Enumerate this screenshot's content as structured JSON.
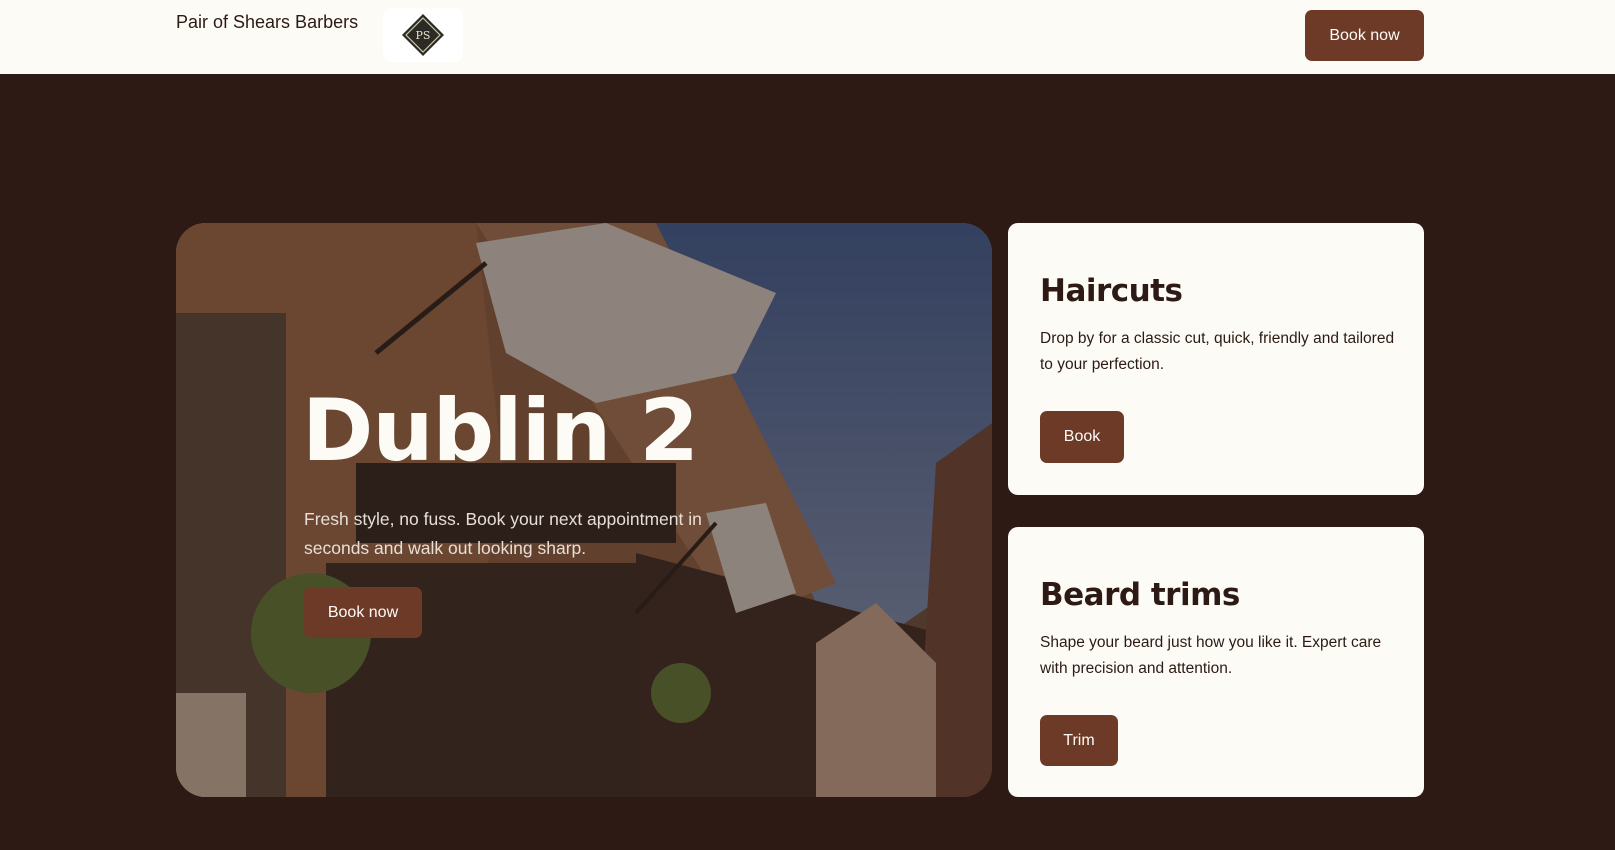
{
  "header": {
    "brand": "Pair of Shears Barbers",
    "logo_text": "PS",
    "book_label": "Book now"
  },
  "hero": {
    "title": "Dublin 2",
    "text": "Fresh style, no fuss. Book your next appointment in seconds and walk out looking sharp.",
    "button_label": "Book now"
  },
  "services": [
    {
      "title": "Haircuts",
      "text": "Drop by for a classic cut, quick, friendly and tailored to your perfection.",
      "button_label": "Book"
    },
    {
      "title": "Beard trims",
      "text": "Shape your beard just how you like it. Expert care with precision and attention.",
      "button_label": "Trim"
    }
  ],
  "colors": {
    "background": "#2d1a14",
    "surface": "#fcfbf6",
    "accent": "#6e3a28"
  }
}
